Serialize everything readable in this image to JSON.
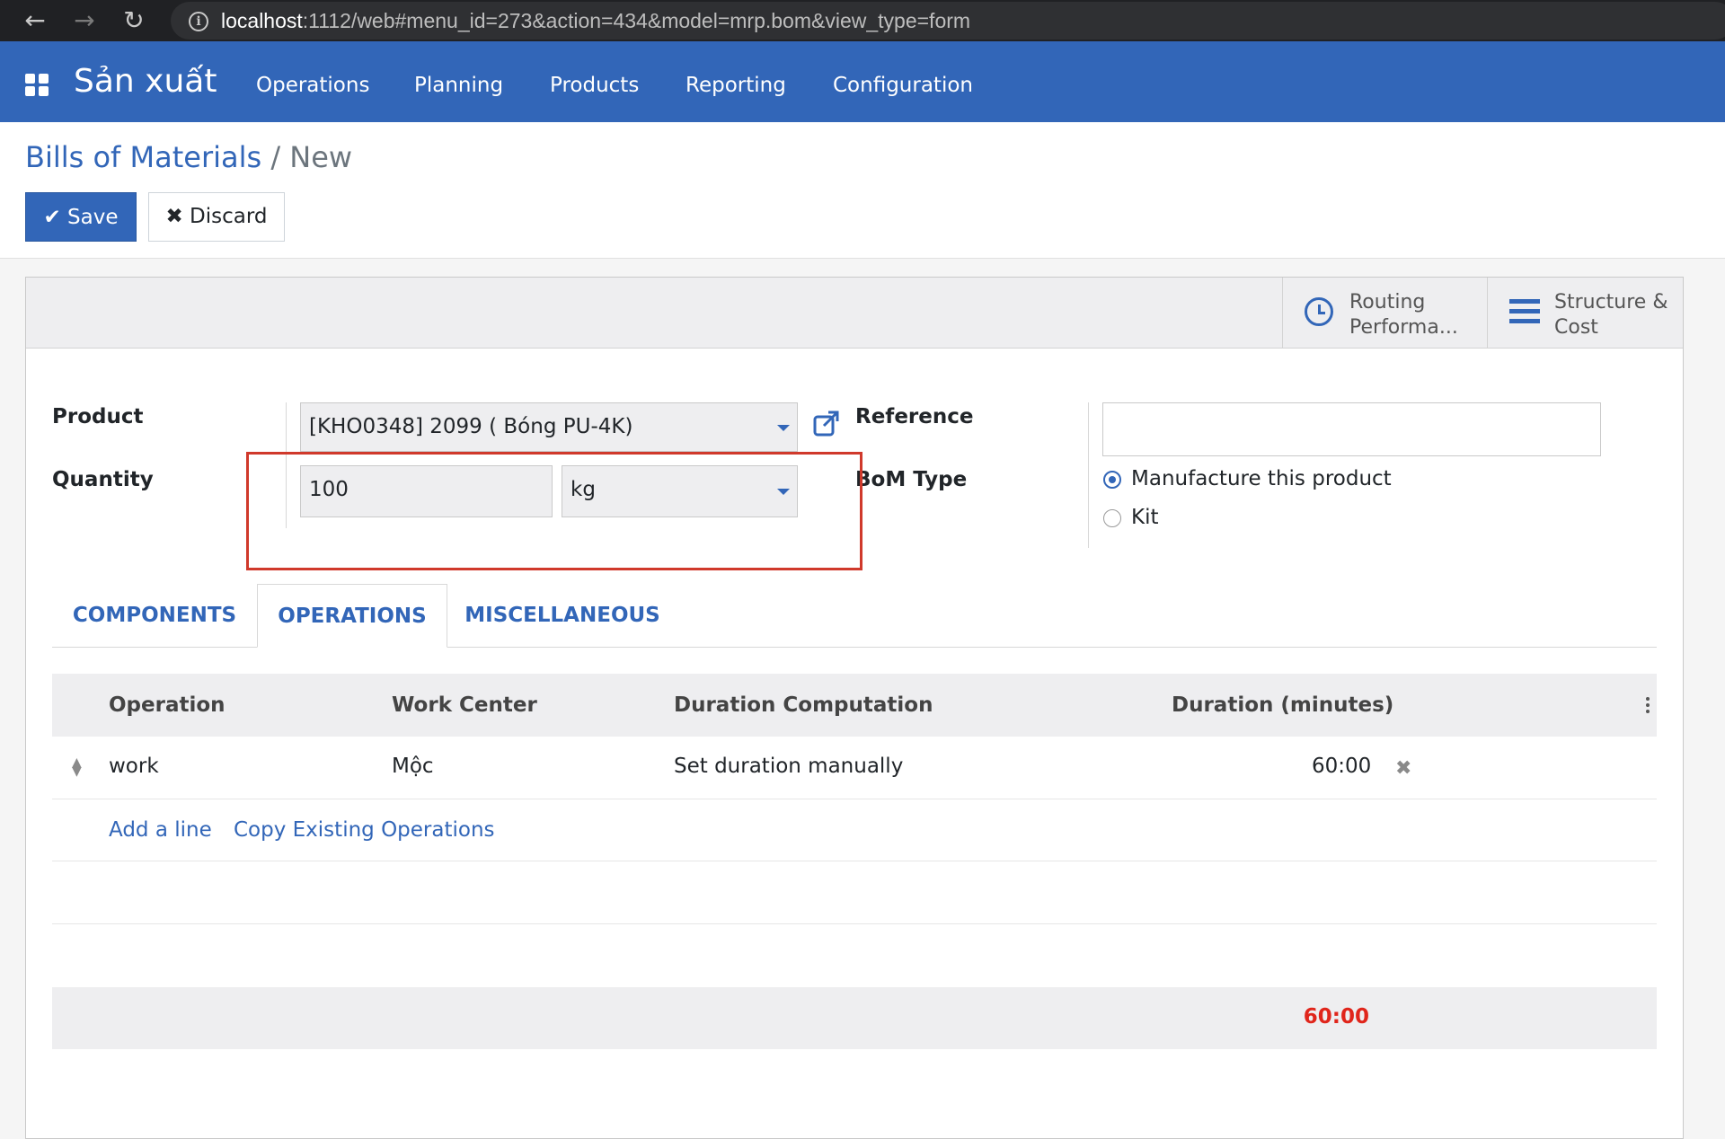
{
  "browser": {
    "back": "←",
    "forward": "→",
    "reload": "↻",
    "info_icon": "i",
    "url_host": "localhost",
    "url_rest": ":1112/web#menu_id=273&action=434&model=mrp.bom&view_type=form"
  },
  "app": {
    "title": "Sản xuất",
    "menu": [
      "Operations",
      "Planning",
      "Products",
      "Reporting",
      "Configuration"
    ]
  },
  "breadcrumb": {
    "parent": "Bills of Materials",
    "separator": "/",
    "current": "New"
  },
  "buttons": {
    "save": "✔ Save",
    "discard": "✖ Discard"
  },
  "smart_buttons": {
    "routing_line1": "Routing",
    "routing_line2": "Performa...",
    "structure_line1": "Structure &",
    "structure_line2": "Cost"
  },
  "form": {
    "product_label": "Product",
    "product_value": "[KHO0348] 2099 ( Bóng PU-4K)",
    "quantity_label": "Quantity",
    "quantity_value": "100",
    "uom_value": "kg",
    "reference_label": "Reference",
    "reference_value": "",
    "bom_type_label": "BoM Type",
    "bom_type_options": [
      "Manufacture this product",
      "Kit"
    ],
    "bom_type_selected": "Manufacture this product"
  },
  "tabs": [
    "COMPONENTS",
    "OPERATIONS",
    "MISCELLANEOUS"
  ],
  "active_tab": "OPERATIONS",
  "operations_table": {
    "columns": [
      "Operation",
      "Work Center",
      "Duration Computation",
      "Duration (minutes)"
    ],
    "rows": [
      {
        "operation": "work",
        "work_center": "Mộc",
        "duration_computation": "Set duration manually",
        "duration": "60:00"
      }
    ],
    "add_line": "Add a line",
    "copy_existing": "Copy Existing Operations",
    "total_duration": "60:00"
  },
  "colors": {
    "brand": "#3266b8",
    "total": "#e0251b",
    "highlight": "#d0392b"
  }
}
